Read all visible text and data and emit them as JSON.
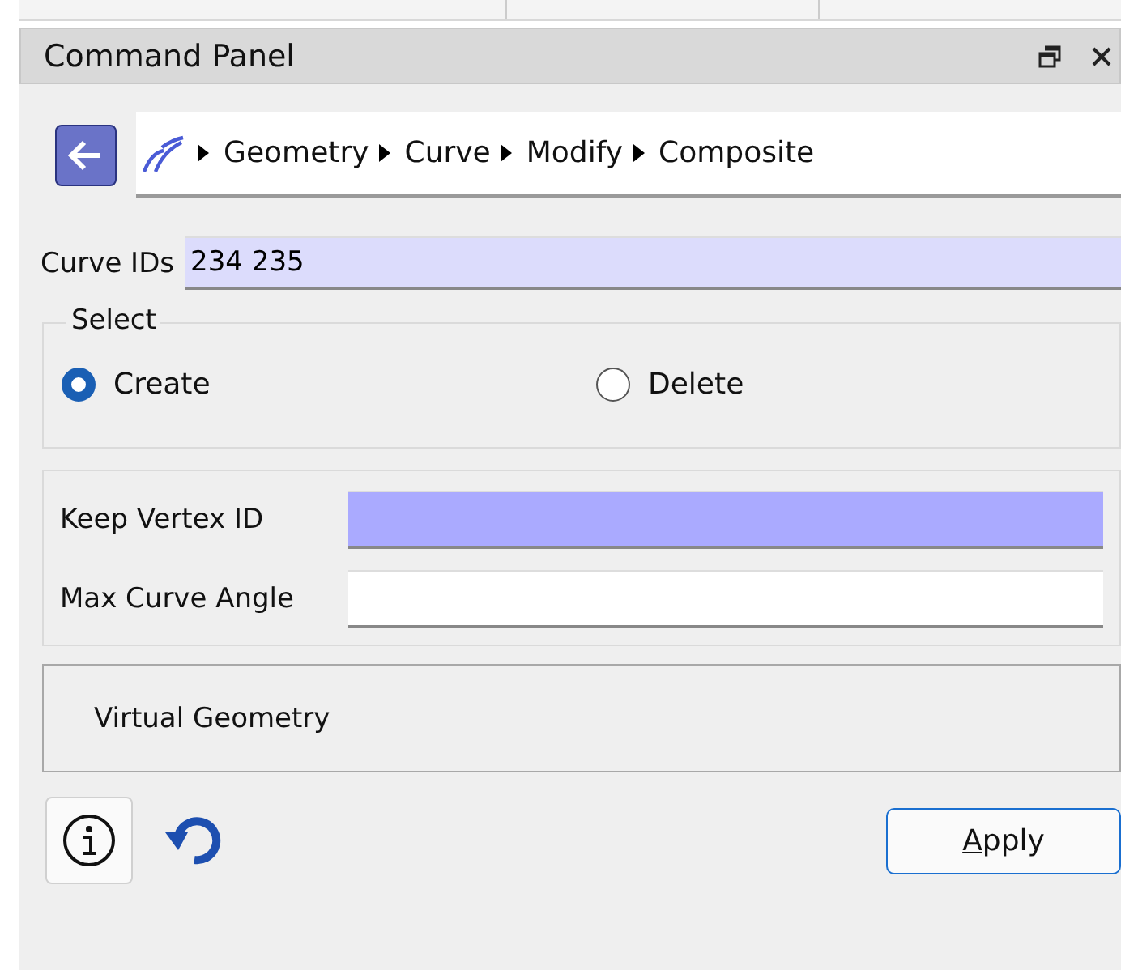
{
  "panel": {
    "title": "Command Panel"
  },
  "breadcrumb": [
    "Geometry",
    "Curve",
    "Modify",
    "Composite"
  ],
  "curve_ids": {
    "label": "Curve IDs",
    "value": "234 235",
    "highlighted": true
  },
  "select": {
    "title": "Select",
    "options": [
      {
        "label": "Create",
        "selected": true
      },
      {
        "label": "Delete",
        "selected": false
      }
    ]
  },
  "options": [
    {
      "label": "Keep Vertex ID",
      "active": true
    },
    {
      "label": "Max Curve Angle",
      "active": false
    }
  ],
  "section": {
    "title": "Virtual Geometry"
  },
  "apply_button": "Apply"
}
